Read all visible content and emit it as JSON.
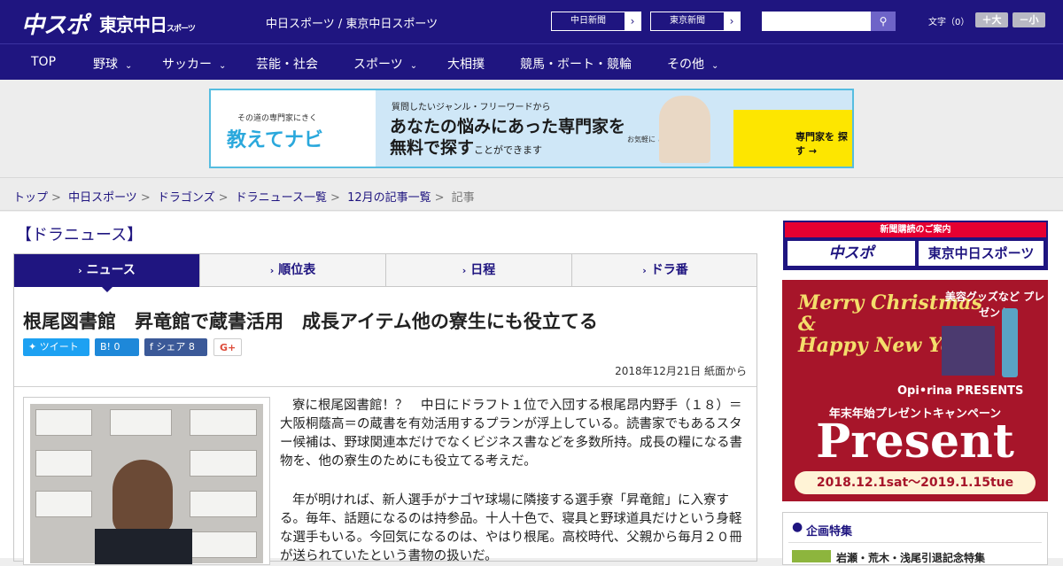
{
  "header": {
    "logo_chuspo": "中スポ",
    "logo_tokyo": "東京中日",
    "logo_tokyo_small": "スポーツ",
    "site_name": "中日スポーツ / 東京中日スポーツ",
    "paper_buttons": [
      "中日新聞",
      "東京新聞"
    ],
    "search_placeholder": "",
    "font_size_label": "文字（0）",
    "font_plus": "＋大",
    "font_minus": "－小"
  },
  "nav": [
    "TOP",
    "野球",
    "サッカー",
    "芸能・社会",
    "スポーツ",
    "大相撲",
    "競馬・ボート・競輪",
    "その他"
  ],
  "ad": {
    "left_small": "その道の専門家にきく",
    "left_logo": "教えてナビ",
    "line1": "質問したいジャンル・フリーワードから",
    "line2": "あなたの悩みにあった専門家を",
    "line3a": "無料で探す",
    "line3b": "ことができます",
    "note": "お気軽に ご質問ください！",
    "cta": "専門家を 探す →"
  },
  "breadcrumbs": [
    "トップ",
    "中日スポーツ",
    "ドラゴンズ",
    "ドラニュース一覧",
    "12月の記事一覧"
  ],
  "breadcrumb_current": "記事",
  "category": "【ドラニュース】",
  "tabs": [
    "ニュース",
    "順位表",
    "日程",
    "ドラ番"
  ],
  "article": {
    "headline": "根尾図書館　昇竜館で蔵書活用　成長アイテム他の寮生にも役立てる",
    "share": {
      "tweet": "ツイート",
      "hatena": "B! 0",
      "facebook": "シェア 8",
      "gplus": "G+"
    },
    "date": "2018年12月21日 紙面から",
    "p1": "寮に根尾図書館！？　中日にドラフト１位で入団する根尾昂内野手（１８）＝大阪桐蔭高＝の蔵書を有効活用するプランが浮上している。読書家でもあるスター候補は、野球関連本だけでなくビジネス書などを多数所持。成長の糧になる書物を、他の寮生のためにも役立てる考えだ。",
    "p2": "年が明ければ、新人選手がナゴヤ球場に隣接する選手寮「昇竜館」に入寮する。毎年、話題になるのは持参品。十人十色で、寝具と野球道具だけという身軽な選手もいる。今回気になるのは、やはり根尾。高校時代、父親から毎月２０冊が送られていたという書物の扱いだ。"
  },
  "sidebar": {
    "subscribe_header": "新聞購読のご案内",
    "subscribe_left": "中スポ",
    "subscribe_right": "東京中日スポーツ",
    "xmas_merry": "Merry Christmas",
    "xmas_and": "&",
    "xmas_newyear": "Happy New Year",
    "xmas_beauty": "美容グッズなど プレゼント",
    "xmas_brand": "Opi•rina PRESENTS",
    "xmas_campaign": "年末年始プレゼントキャンペーン",
    "xmas_present": "Present",
    "xmas_dates": "2018.12.1sat～2019.1.15tue",
    "feature_title": "企画特集",
    "feature_item": "岩瀬・荒木・浅尾引退記念特集"
  }
}
